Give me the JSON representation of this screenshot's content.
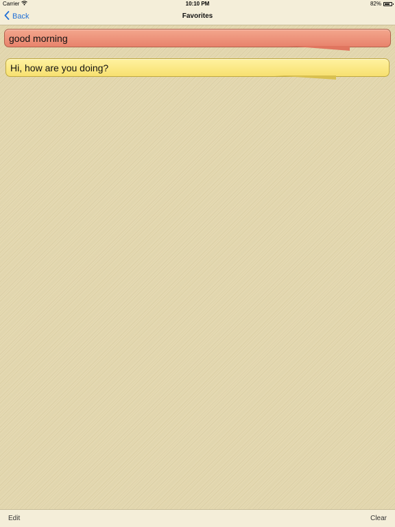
{
  "status_bar": {
    "carrier": "Carrier",
    "time": "10:10 PM",
    "battery_percent": "82%",
    "battery_level": 0.82,
    "wifi_icon": "wifi-icon",
    "battery_icon": "battery-icon"
  },
  "nav": {
    "back_label": "Back",
    "back_icon": "chevron-left-icon",
    "title": "Favorites",
    "accent_color": "#1f6fd6"
  },
  "favorites": [
    {
      "text": "good morning",
      "color": "#ee927a"
    },
    {
      "text": "Hi, how are you doing?",
      "color": "#fbe989"
    }
  ],
  "toolbar": {
    "edit_label": "Edit",
    "clear_label": "Clear"
  }
}
